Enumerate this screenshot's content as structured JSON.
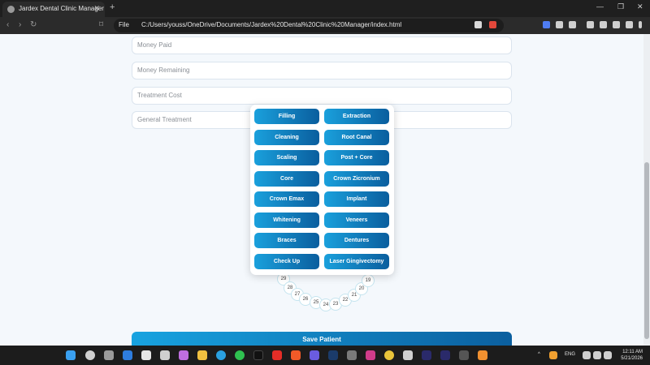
{
  "browser": {
    "tab_title": "Jardex Dental Clinic Manager",
    "tab_close": "✕",
    "new_tab": "+",
    "url_scheme": "File",
    "url": "C:/Users/youss/OneDrive/Documents/Jardex%20Dental%20Clinic%20Manager/index.html"
  },
  "form": {
    "money_paid_placeholder": "Money Paid",
    "money_remaining_placeholder": "Money Remaining",
    "treatment_cost_placeholder": "Treatment Cost",
    "general_treatment_placeholder": "General Treatment"
  },
  "treatments": {
    "filling": "Filling",
    "extraction": "Extraction",
    "cleaning": "Cleaning",
    "root_canal": "Root Canal",
    "scaling": "Scaling",
    "post_core": "Post + Core",
    "core": "Core",
    "crown_zicronium": "Crown Zicronium",
    "crown_emax": "Crown Emax",
    "implant": "Implant",
    "whitening": "Whitening",
    "veneers": "Veneers",
    "braces": "Braces",
    "dentures": "Dentures",
    "check_up": "Check Up",
    "laser_gingivectomy": "Laser Gingivectomy"
  },
  "teeth": [
    "29",
    "28",
    "27",
    "26",
    "25",
    "24",
    "23",
    "22",
    "21",
    "20",
    "19"
  ],
  "save_label": "Save Patient",
  "taskbar": {
    "language": "ENG",
    "time": "12:11 AM",
    "date": "5/21/2026"
  },
  "colors": {
    "button_gradient_start": "#1aa0dc",
    "button_gradient_end": "#0a5e9e"
  }
}
